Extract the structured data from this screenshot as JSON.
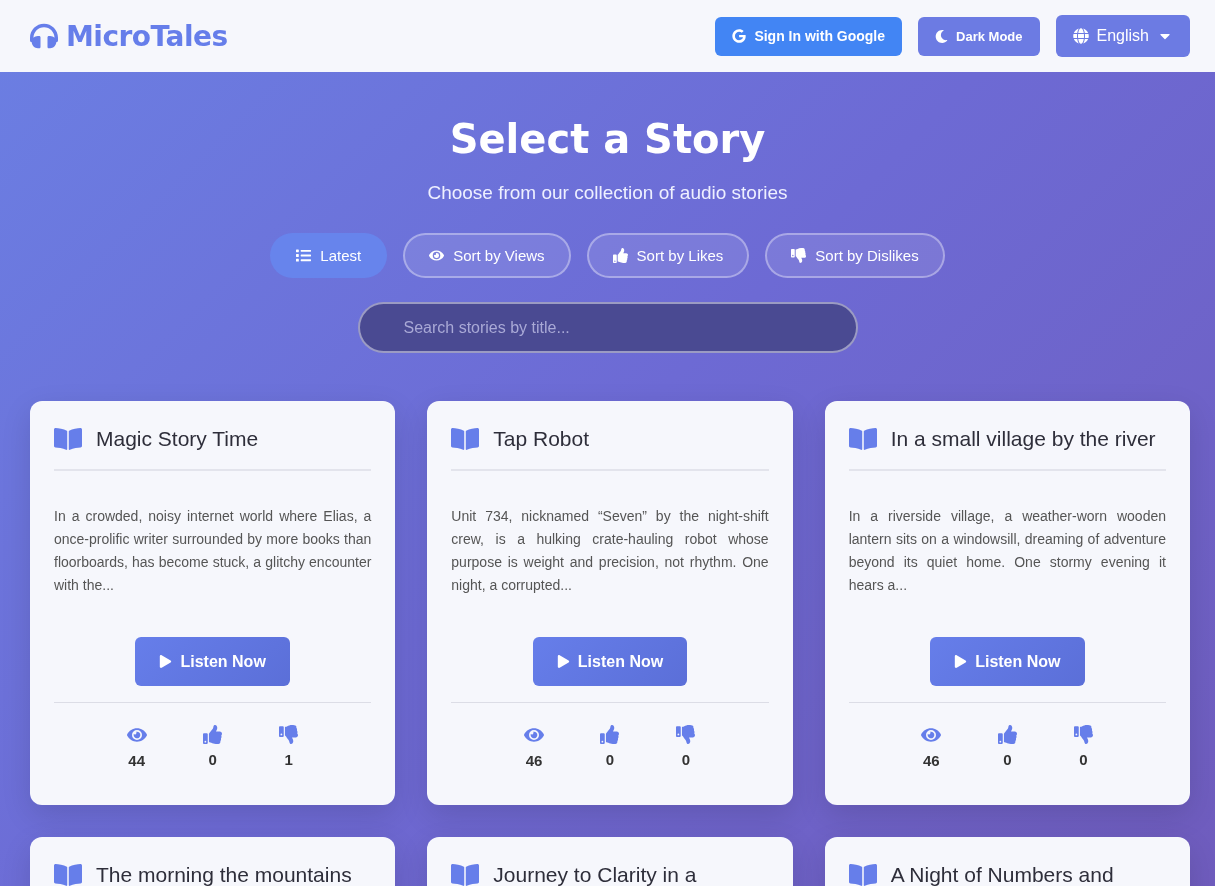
{
  "header": {
    "logo": "MicroTales",
    "sign_in": "Sign In with Google",
    "dark_mode": "Dark Mode",
    "language": "English"
  },
  "hero": {
    "title": "Select a Story",
    "subtitle": "Choose from our collection of audio stories"
  },
  "sort_tabs": [
    {
      "kind": "list",
      "label": "Latest",
      "selected": true
    },
    {
      "kind": "views",
      "label": "Sort by Views",
      "selected": false
    },
    {
      "kind": "likes",
      "label": "Sort by Likes",
      "selected": false
    },
    {
      "kind": "dislikes",
      "label": "Sort by Dislikes",
      "selected": false
    }
  ],
  "search": {
    "placeholder": "Search stories by title..."
  },
  "stories": [
    {
      "title": "Magic Story Time",
      "description": "In a crowded, noisy internet world where Elias, a once-prolific writer surrounded by more books than floorboards, has become stuck, a glitchy encounter with the...",
      "button": "Listen Now",
      "views": "44",
      "likes": "0",
      "dislikes": "1"
    },
    {
      "title": "Tap Robot",
      "description": "Unit 734, nicknamed “Seven” by the night-shift crew, is a hulking crate-hauling robot whose purpose is weight and precision, not rhythm. One night, a corrupted...",
      "button": "Listen Now",
      "views": "46",
      "likes": "0",
      "dislikes": "0"
    },
    {
      "title": "In a small village by the river",
      "description": "In a riverside village, a weather-worn wooden lantern sits on a windowsill, dreaming of adventure beyond its quiet home. One stormy evening it hears a...",
      "button": "Listen Now",
      "views": "46",
      "likes": "0",
      "dislikes": "0"
    },
    {
      "title": "The morning the mountains"
    },
    {
      "title": "Journey to Clarity in a"
    },
    {
      "title": "A Night of Numbers and"
    }
  ]
}
